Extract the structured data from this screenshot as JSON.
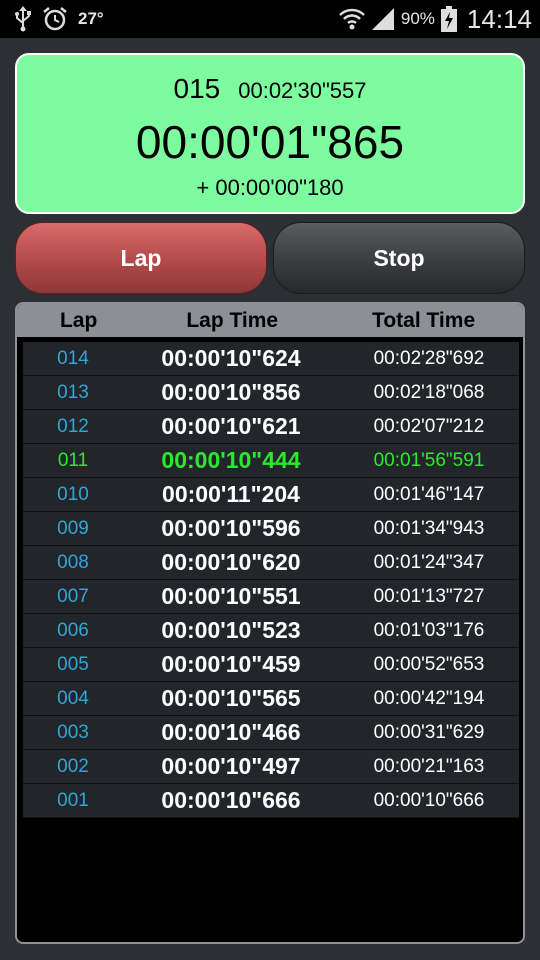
{
  "status_bar": {
    "temperature": "27°",
    "battery_percent": "90%",
    "time": "14:14",
    "icons": [
      "usb-icon",
      "alarm-icon",
      "wifi-icon",
      "signal-icon",
      "battery-charging-icon"
    ]
  },
  "timer": {
    "lap_count": "015",
    "total_time": "00:02'30\"557",
    "current_lap": "00:00'01\"865",
    "diff": "+ 00:00'00\"180"
  },
  "buttons": {
    "lap": "Lap",
    "stop": "Stop"
  },
  "table": {
    "headers": {
      "lap": "Lap",
      "lap_time": "Lap Time",
      "total_time": "Total Time"
    },
    "rows": [
      {
        "lap": "014",
        "lap_time": "00:00'10\"624",
        "total": "00:02'28\"692",
        "best": false
      },
      {
        "lap": "013",
        "lap_time": "00:00'10\"856",
        "total": "00:02'18\"068",
        "best": false
      },
      {
        "lap": "012",
        "lap_time": "00:00'10\"621",
        "total": "00:02'07\"212",
        "best": false
      },
      {
        "lap": "011",
        "lap_time": "00:00'10\"444",
        "total": "00:01'56\"591",
        "best": true
      },
      {
        "lap": "010",
        "lap_time": "00:00'11\"204",
        "total": "00:01'46\"147",
        "best": false
      },
      {
        "lap": "009",
        "lap_time": "00:00'10\"596",
        "total": "00:01'34\"943",
        "best": false
      },
      {
        "lap": "008",
        "lap_time": "00:00'10\"620",
        "total": "00:01'24\"347",
        "best": false
      },
      {
        "lap": "007",
        "lap_time": "00:00'10\"551",
        "total": "00:01'13\"727",
        "best": false
      },
      {
        "lap": "006",
        "lap_time": "00:00'10\"523",
        "total": "00:01'03\"176",
        "best": false
      },
      {
        "lap": "005",
        "lap_time": "00:00'10\"459",
        "total": "00:00'52\"653",
        "best": false
      },
      {
        "lap": "004",
        "lap_time": "00:00'10\"565",
        "total": "00:00'42\"194",
        "best": false
      },
      {
        "lap": "003",
        "lap_time": "00:00'10\"466",
        "total": "00:00'31\"629",
        "best": false
      },
      {
        "lap": "002",
        "lap_time": "00:00'10\"497",
        "total": "00:00'21\"163",
        "best": false
      },
      {
        "lap": "001",
        "lap_time": "00:00'10\"666",
        "total": "00:00'10\"666",
        "best": false
      }
    ]
  },
  "colors": {
    "timer_bg": "#7dfc9f",
    "lap_button": "#c85757",
    "stop_button": "#3a3c3f",
    "lap_number": "#2fa6d6",
    "best_lap": "#2bea2b"
  }
}
